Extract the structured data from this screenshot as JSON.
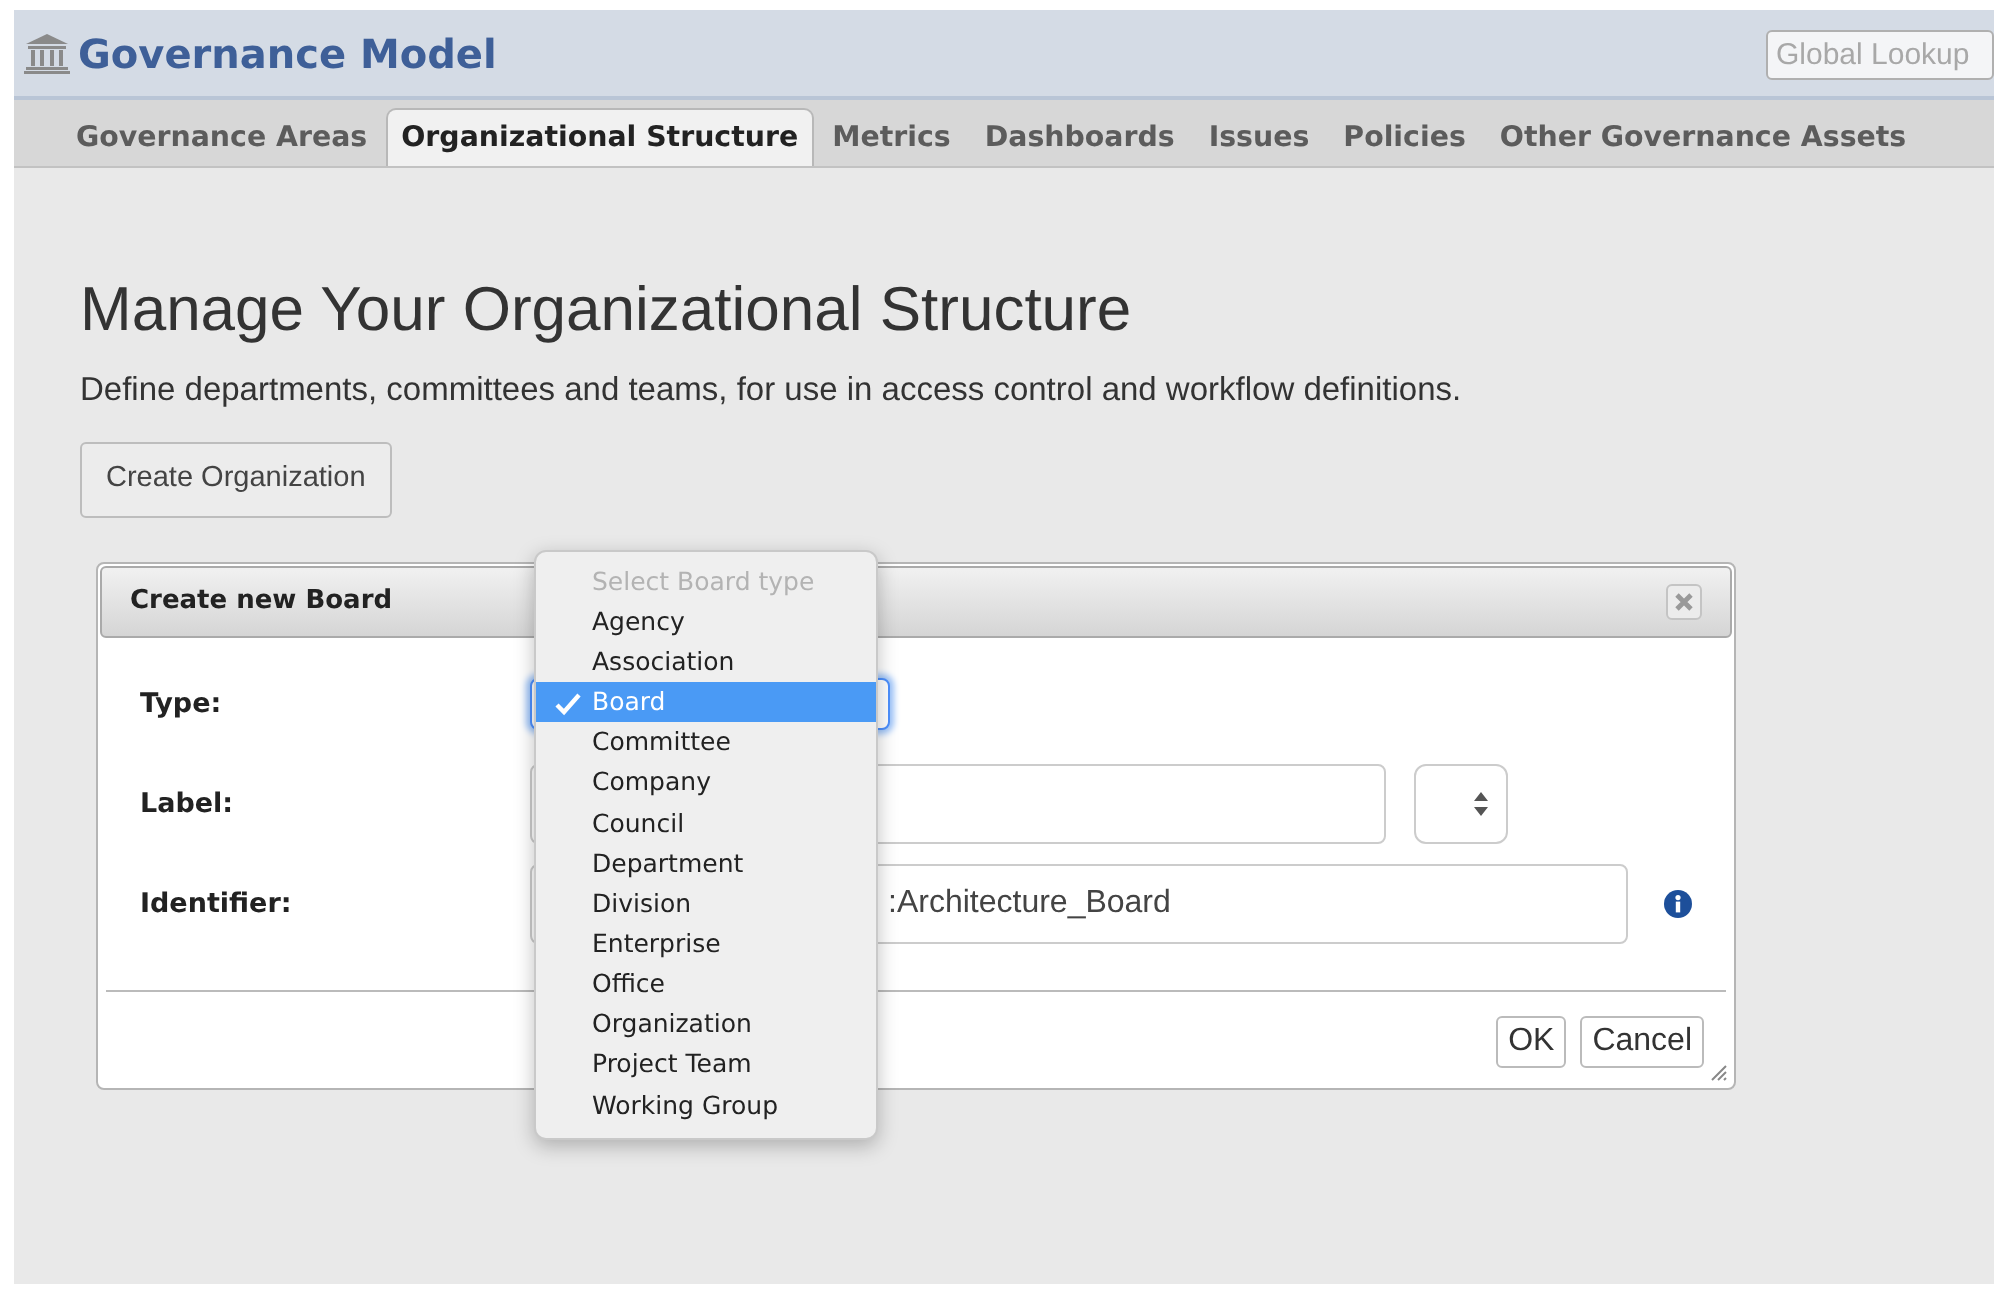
{
  "header": {
    "title": "Governance Model",
    "search": {
      "placeholder": "Global Lookup"
    }
  },
  "tabs": [
    {
      "label": "Governance Areas",
      "selected": false
    },
    {
      "label": "Organizational Structure",
      "selected": true
    },
    {
      "label": "Metrics",
      "selected": false
    },
    {
      "label": "Dashboards",
      "selected": false
    },
    {
      "label": "Issues",
      "selected": false
    },
    {
      "label": "Policies",
      "selected": false
    },
    {
      "label": "Other Governance Assets",
      "selected": false
    }
  ],
  "page": {
    "title": "Manage Your Organizational Structure",
    "description": "Define departments, committees and teams, for use in access control and workflow definitions.",
    "create_button": "Create Organization"
  },
  "dialog": {
    "title": "Create new Board",
    "fields": [
      {
        "label": "Type:",
        "kind": "select",
        "focused": true
      },
      {
        "label": "Label:",
        "kind": "text_with_select"
      },
      {
        "label": "Identifier:",
        "kind": "text_info",
        "value": ":Architecture_Board"
      }
    ],
    "buttons": [
      "OK",
      "Cancel"
    ]
  },
  "dropdown": {
    "prompt": "Select Board type",
    "options": [
      {
        "label": "Agency",
        "selected": false
      },
      {
        "label": "Association",
        "selected": false
      },
      {
        "label": "Board",
        "selected": true
      },
      {
        "label": "Committee",
        "selected": false
      },
      {
        "label": "Company",
        "selected": false
      },
      {
        "label": "Council",
        "selected": false
      },
      {
        "label": "Department",
        "selected": false
      },
      {
        "label": "Division",
        "selected": false
      },
      {
        "label": "Enterprise",
        "selected": false
      },
      {
        "label": "Office",
        "selected": false
      },
      {
        "label": "Organization",
        "selected": false
      },
      {
        "label": "Project Team",
        "selected": false
      },
      {
        "label": "Working Group",
        "selected": false
      }
    ]
  }
}
